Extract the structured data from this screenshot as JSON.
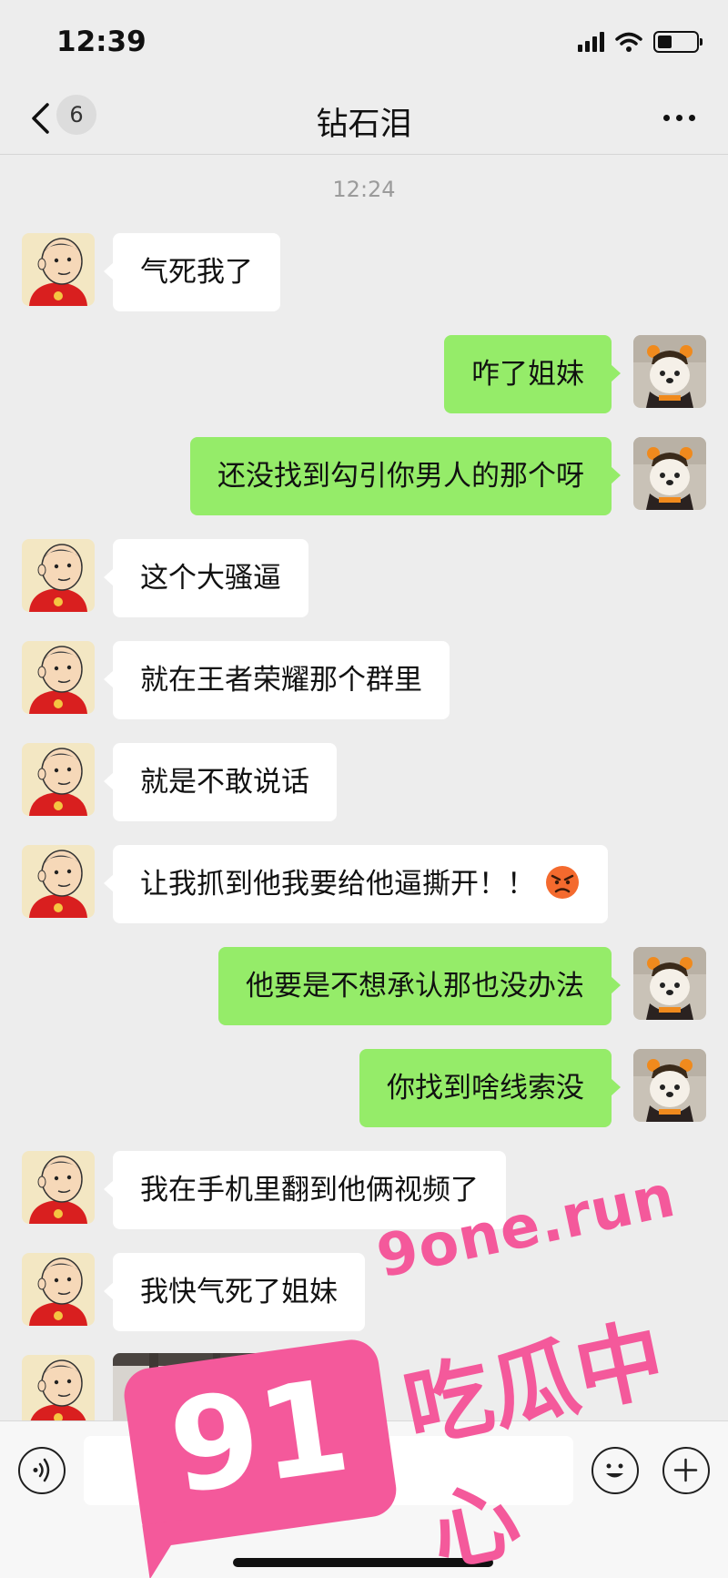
{
  "status_bar": {
    "time": "12:39"
  },
  "nav": {
    "unread_count": "6",
    "title": "钻石泪"
  },
  "timestamp": "12:24",
  "messages": [
    {
      "side": "left",
      "text": "气死我了"
    },
    {
      "side": "right",
      "text": "咋了姐妹"
    },
    {
      "side": "right",
      "text": "还没找到勾引你男人的那个呀"
    },
    {
      "side": "left",
      "text": "这个大骚逼"
    },
    {
      "side": "left",
      "text": "就在王者荣耀那个群里"
    },
    {
      "side": "left",
      "text": "就是不敢说话"
    },
    {
      "side": "left",
      "text": "让我抓到他我要给他逼撕开！！",
      "emoji": "angry-face-emoji"
    },
    {
      "side": "right",
      "text": "他要是不想承认那也没办法"
    },
    {
      "side": "right",
      "text": "你找到啥线索没"
    },
    {
      "side": "left",
      "text": "我在手机里翻到他俩视频了"
    },
    {
      "side": "left",
      "text": "我快气死了姐妹"
    }
  ],
  "watermark": {
    "logo": "91",
    "domain": "9one.run",
    "site_name": "吃瓜中心"
  },
  "colors": {
    "background": "#ededed",
    "sent_bubble": "#95ec69",
    "received_bubble": "#ffffff",
    "watermark": "#f4599b"
  },
  "icons": {
    "back": "chevron-left-icon",
    "more": "more-dots-icon",
    "voice": "voice-icon",
    "emoji": "emoji-icon",
    "plus": "plus-icon"
  }
}
